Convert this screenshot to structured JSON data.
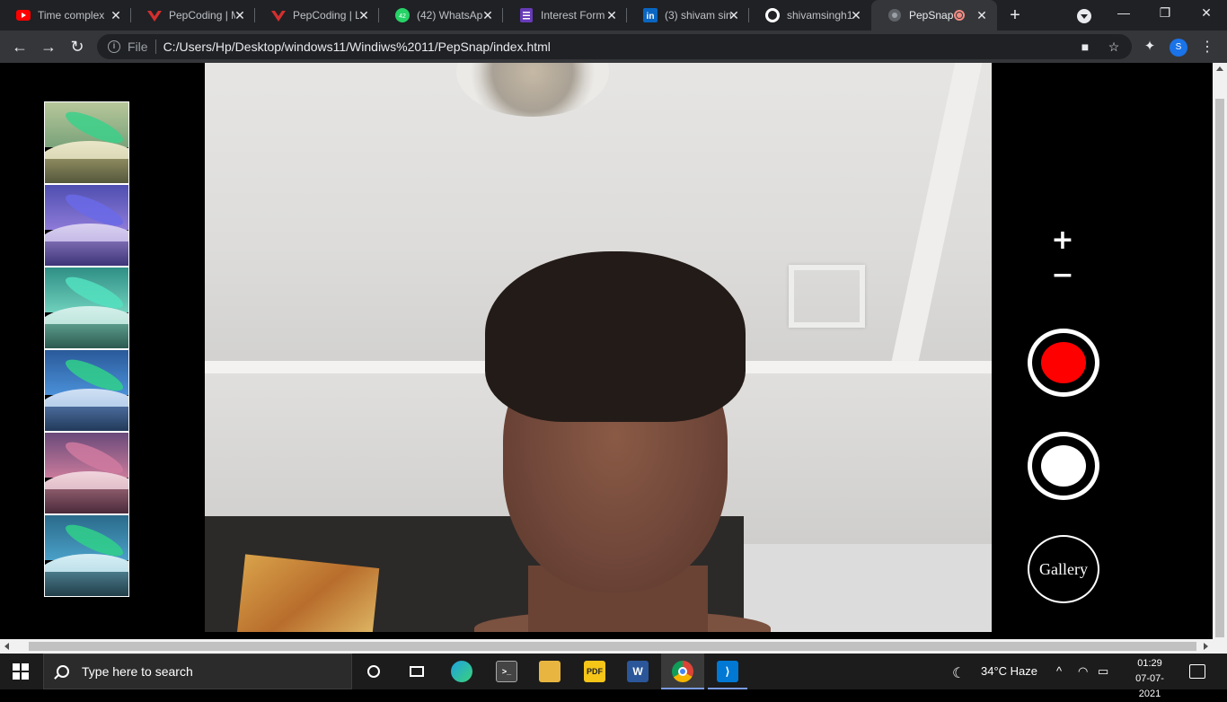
{
  "browser": {
    "tabs": [
      {
        "title": "Time complex",
        "favicon": "youtube-icon",
        "color": "#ff0000"
      },
      {
        "title": "PepCoding | M",
        "favicon": "pepcoding-icon",
        "color": "#d32f2f"
      },
      {
        "title": "PepCoding | L",
        "favicon": "pepcoding-icon",
        "color": "#d32f2f"
      },
      {
        "title": "(42) WhatsAp",
        "favicon": "whatsapp-icon",
        "color": "#25d366",
        "badge": "42"
      },
      {
        "title": "Interest Form",
        "favicon": "forms-icon",
        "color": "#673ab7"
      },
      {
        "title": "(3) shivam sin",
        "favicon": "linkedin-icon",
        "color": "#0a66c2"
      },
      {
        "title": "shivamsingh1",
        "favicon": "github-icon",
        "color": "#ffffff"
      },
      {
        "title": "PepSnap",
        "favicon": "globe-icon",
        "color": "#9aa0a6",
        "active": true
      }
    ],
    "address": {
      "scheme_label": "File",
      "url": "C:/Users/Hp/Desktop/windows11/Windiws%2011/PepSnap/index.html"
    },
    "profile_initial": "S"
  },
  "app": {
    "zoom_in_label": "+",
    "zoom_out_label": "−",
    "gallery_label": "Gallery",
    "record_color": "#ff0000",
    "filters": [
      {
        "name": "filter-yellow",
        "tint": "#c8c87a"
      },
      {
        "name": "filter-purple",
        "tint": "#8a7ad8"
      },
      {
        "name": "filter-teal",
        "tint": "#5fc8b4"
      },
      {
        "name": "filter-blue",
        "tint": "#4a90d8"
      },
      {
        "name": "filter-pink",
        "tint": "#c86a8a"
      },
      {
        "name": "filter-cyan",
        "tint": "#4aa0c8"
      }
    ]
  },
  "taskbar": {
    "search_placeholder": "Type here to search",
    "weather": "34°C  Haze",
    "time": "01:29",
    "date": "07-07-2021"
  }
}
